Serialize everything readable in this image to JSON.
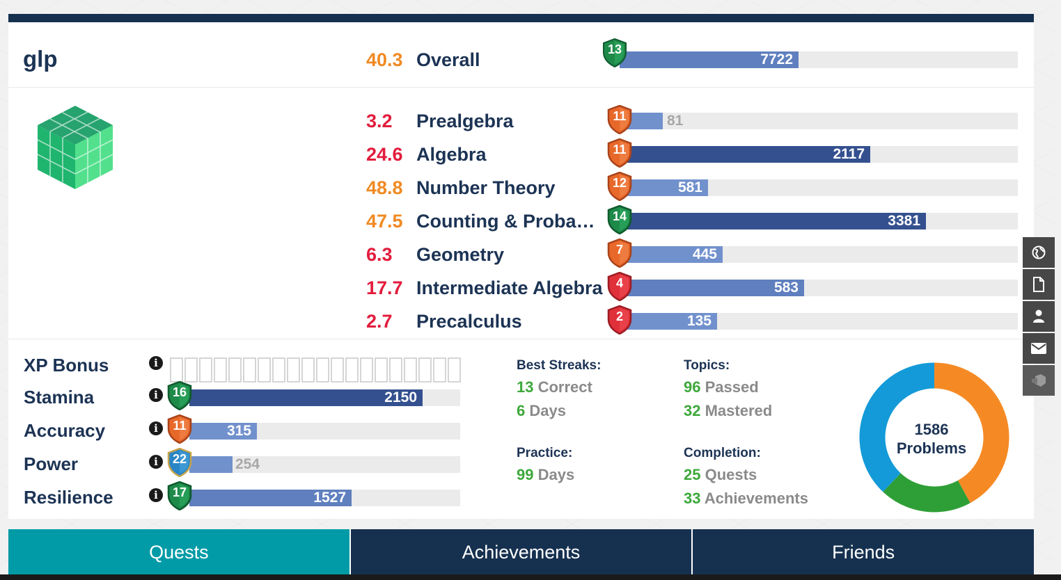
{
  "user": {
    "name": "glp"
  },
  "overall": {
    "score": "40.3",
    "label": "Overall",
    "level": "13",
    "xp": "7722",
    "fill": 0.45
  },
  "topics": [
    {
      "score": "3.2",
      "name": "Prealgebra",
      "level": "11",
      "xp": "81",
      "fill": 0.109,
      "score_color": "red",
      "shield": "orange",
      "bar": "light",
      "val_out": true
    },
    {
      "score": "24.6",
      "name": "Algebra",
      "level": "11",
      "xp": "2117",
      "fill": 0.63,
      "score_color": "red",
      "shield": "orange",
      "bar": "dark"
    },
    {
      "score": "48.8",
      "name": "Number Theory",
      "level": "12",
      "xp": "581",
      "fill": 0.222,
      "score_color": "orange",
      "shield": "orange",
      "bar": "light"
    },
    {
      "score": "47.5",
      "name": "Counting & Probability",
      "level": "14",
      "xp": "3381",
      "fill": 0.769,
      "score_color": "orange",
      "shield": "green",
      "bar": "dark"
    },
    {
      "score": "6.3",
      "name": "Geometry",
      "level": "7",
      "xp": "445",
      "fill": 0.259,
      "score_color": "red",
      "shield": "orange",
      "bar": "light"
    },
    {
      "score": "17.7",
      "name": "Intermediate Algebra",
      "level": "4",
      "xp": "583",
      "fill": 0.464,
      "score_color": "red",
      "shield": "red",
      "bar": "mid"
    },
    {
      "score": "2.7",
      "name": "Precalculus",
      "level": "2",
      "xp": "135",
      "fill": 0.245,
      "score_color": "red",
      "shield": "red",
      "bar": "light"
    }
  ],
  "stats": {
    "xp_bonus": {
      "label": "XP Bonus",
      "boxes": 20,
      "filled": 0
    },
    "items": [
      {
        "label": "Stamina",
        "level": "16",
        "value": "2150",
        "fill": 0.86,
        "shield": "green",
        "bar": "dark"
      },
      {
        "label": "Accuracy",
        "level": "11",
        "value": "315",
        "fill": 0.25,
        "shield": "orange",
        "bar": "light"
      },
      {
        "label": "Power",
        "level": "22",
        "value": "254",
        "fill": 0.16,
        "shield": "blue",
        "bar": "light",
        "val_out": true
      },
      {
        "label": "Resilience",
        "level": "17",
        "value": "1527",
        "fill": 0.6,
        "shield": "green",
        "bar": "mid"
      }
    ]
  },
  "best_streaks": {
    "heading": "Best Streaks:",
    "correct_num": "13",
    "correct_label": "Correct",
    "days_num": "6",
    "days_label": "Days"
  },
  "practice": {
    "heading": "Practice:",
    "days_num": "99",
    "days_label": "Days"
  },
  "topics_summary": {
    "heading": "Topics:",
    "passed_num": "96",
    "passed_label": "Passed",
    "mastered_num": "32",
    "mastered_label": "Mastered"
  },
  "completion": {
    "heading": "Completion:",
    "quests_num": "25",
    "quests_label": "Quests",
    "achievements_num": "33",
    "achievements_label": "Achievements"
  },
  "problems": {
    "count": "1586",
    "label": "Problems",
    "segments": [
      {
        "fraction": 0.42,
        "color": "#f58a25"
      },
      {
        "fraction": 0.2,
        "color": "#2e9f36"
      },
      {
        "fraction": 0.38,
        "color": "#149ad8"
      }
    ]
  },
  "tabs": [
    {
      "label": "Quests",
      "active": true
    },
    {
      "label": "Achievements",
      "active": false
    },
    {
      "label": "Friends",
      "active": false
    }
  ],
  "colors": {
    "navy": "#16304f",
    "teal": "#009ba6",
    "orange": "#f08a23",
    "red": "#e21c3c",
    "green": "#3da83b",
    "shield_green": "#1e8a4a",
    "shield_orange": "#e8682a",
    "shield_red": "#e0303a",
    "shield_blue": "#2a86c6"
  },
  "dock_icons": [
    "globe-icon",
    "document-icon",
    "user-icon",
    "envelope-icon",
    "cube-icon"
  ]
}
